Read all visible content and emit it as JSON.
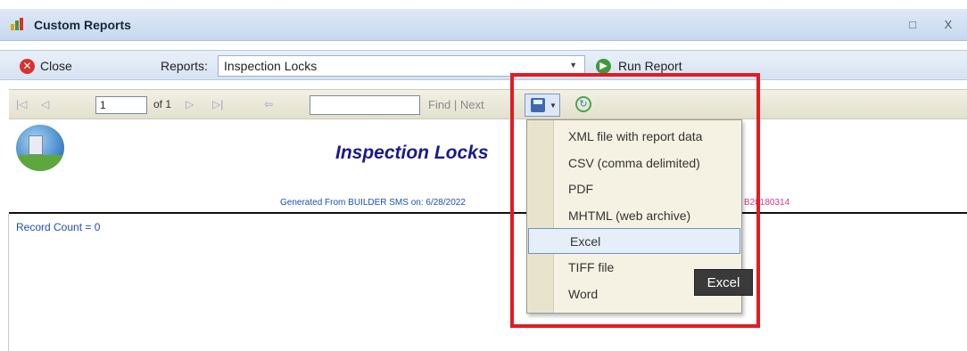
{
  "window": {
    "title": "Custom Reports",
    "restore_glyph": "□",
    "close_glyph": "X"
  },
  "toolbar": {
    "close_label": "Close",
    "reports_label": "Reports:",
    "reports_value": "Inspection Locks",
    "run_label": "Run Report"
  },
  "viewer": {
    "first_glyph": "|◁",
    "prev_glyph": "◁",
    "page_value": "1",
    "of_label": "of 1",
    "next_glyph": "▷",
    "last_glyph": "▷|",
    "back_glyph": "⇦",
    "find_value": "",
    "find_label": "Find | Next"
  },
  "report": {
    "title": "Inspection Locks",
    "generated_text": "Generated From BUILDER SMS on:   6/28/2022",
    "generated_tail": "B20180314",
    "record_count": "Record Count = 0"
  },
  "export_menu": {
    "items": [
      {
        "label": "XML file with report data"
      },
      {
        "label": "CSV (comma delimited)"
      },
      {
        "label": "PDF"
      },
      {
        "label": "MHTML (web archive)"
      },
      {
        "label": "Excel"
      },
      {
        "label": "TIFF file"
      },
      {
        "label": "Word"
      }
    ],
    "active_index": 4,
    "tooltip": "Excel"
  },
  "colors": {
    "highlight": "#e21b23",
    "close_icon": "#d9322a",
    "run_icon": "#3a9b3a",
    "report_title": "#1a1a8c"
  }
}
